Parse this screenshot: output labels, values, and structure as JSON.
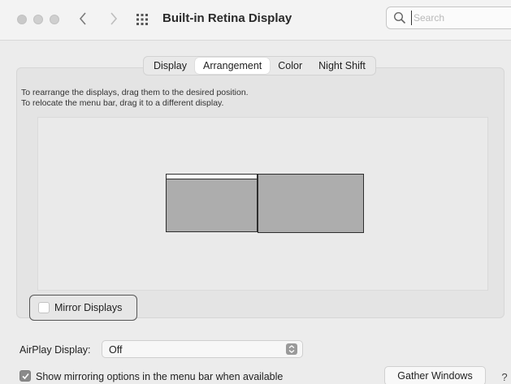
{
  "window": {
    "title": "Built-in Retina Display",
    "nav_back_icon": "chevron-left-icon",
    "nav_forward_icon": "chevron-right-icon",
    "show_all_icon": "grid-icon"
  },
  "search": {
    "placeholder": "Search",
    "value": ""
  },
  "tabs": [
    {
      "label": "Display",
      "active": false
    },
    {
      "label": "Arrangement",
      "active": true
    },
    {
      "label": "Color",
      "active": false
    },
    {
      "label": "Night Shift",
      "active": false
    }
  ],
  "instructions": {
    "line1": "To rearrange the displays, drag them to the desired position.",
    "line2": "To relocate the menu bar, drag it to a different display."
  },
  "mirror": {
    "label": "Mirror Displays",
    "checked": false
  },
  "airplay": {
    "label": "AirPlay Display:",
    "value": "Off"
  },
  "show_mirroring": {
    "label": "Show mirroring options in the menu bar when available",
    "checked": true
  },
  "buttons": {
    "gather_windows": "Gather Windows",
    "help": "?"
  }
}
